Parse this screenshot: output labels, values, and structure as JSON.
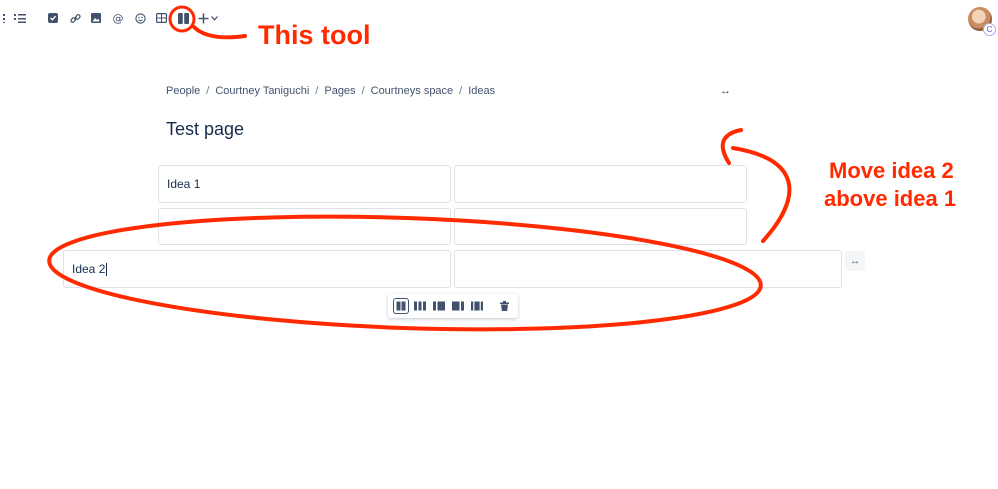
{
  "toolbar": {
    "icons": [
      "list-icon",
      "numbered-list-icon",
      "task-icon",
      "link-icon",
      "image-icon",
      "mention-icon",
      "emoji-icon",
      "table-icon",
      "layouts-icon",
      "insert-plus-icon",
      "chevron-down-icon"
    ]
  },
  "annotations": {
    "tool_label": "This tool",
    "move_line1": "Move idea 2",
    "move_line2": "above idea 1",
    "color": "#ff2a00"
  },
  "breadcrumb": [
    "People",
    "Courtney Taniguchi",
    "Pages",
    "Courtneys space",
    "Ideas"
  ],
  "page": {
    "title": "Test page"
  },
  "layout_rows": [
    {
      "left": "Idea 1",
      "right": ""
    },
    {
      "left": "",
      "right": ""
    },
    {
      "left": "Idea 2",
      "right": ""
    }
  ],
  "layout_options": [
    "two-columns",
    "three-columns",
    "left-sidebar",
    "right-sidebar",
    "three-with-sidebars",
    "delete"
  ],
  "avatar_badge": "C"
}
